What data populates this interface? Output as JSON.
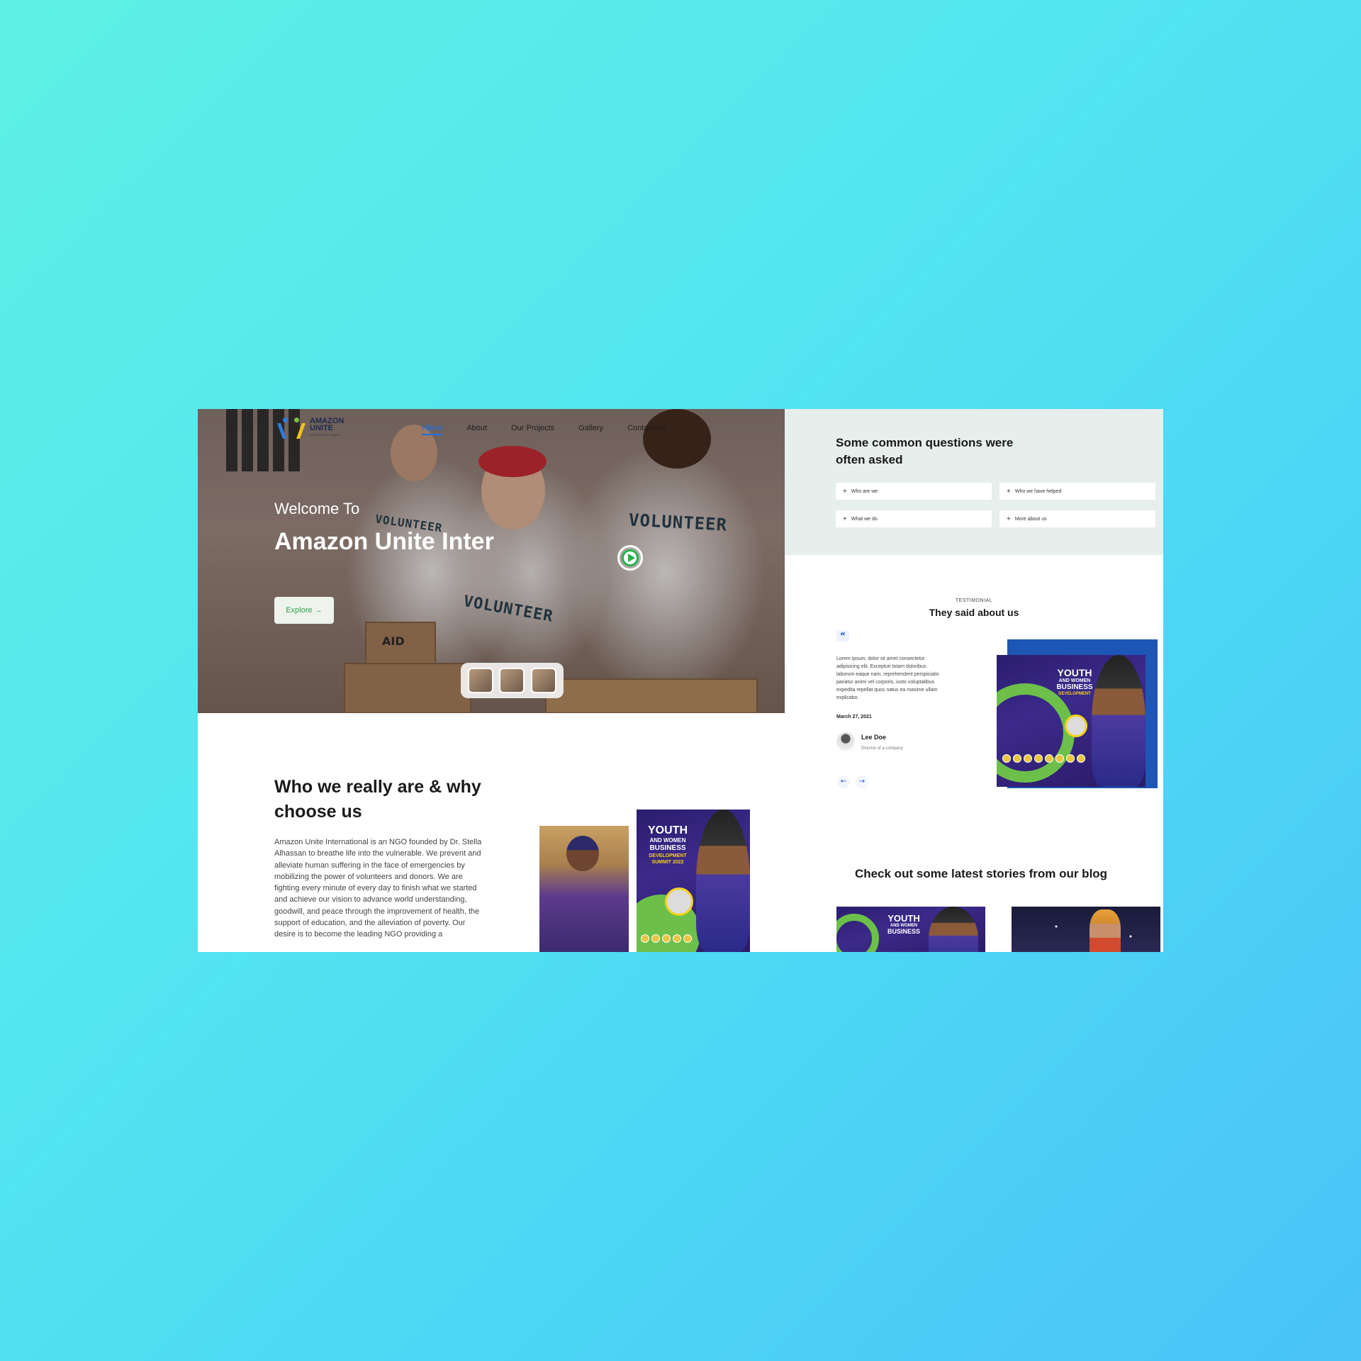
{
  "site": {
    "logo_line1": "AMAZON",
    "logo_line2": "UNITE",
    "logo_line3": "INTERNATIONAL"
  },
  "nav": {
    "items": [
      {
        "label": "Home",
        "active": true
      },
      {
        "label": "About",
        "active": false
      },
      {
        "label": "Our Projects",
        "active": false
      },
      {
        "label": "Gallery",
        "active": false
      },
      {
        "label": "Contact Us",
        "active": false
      }
    ]
  },
  "hero": {
    "subtitle": "Welcome To",
    "title": "Amazon Unite Inter",
    "explore_label": "Explore →",
    "shirt_text": "VOLUNTEER",
    "box_text": "AID"
  },
  "faq": {
    "title": "Some common questions were often asked",
    "items": [
      {
        "label": "Who are we"
      },
      {
        "label": "Who we have helped"
      },
      {
        "label": "What we do"
      },
      {
        "label": "More about us"
      }
    ]
  },
  "testimonial": {
    "kicker": "TESTIMONIAL",
    "title": "They said about us",
    "quote_mark": "“",
    "text": "Lorem ipsum, dolor sit amet consectetur adipisicing elit. Excepturi totam doloribus laborum eaque nam, reprehenderit perspiciatis pariatur animi vel corporis, iusto voluptatibus expedita repellat quos natus ea maxime ullam explicabo.",
    "date": "March 27, 2021",
    "author_name": "Lee Doe",
    "author_role": "Director of a company",
    "prev_icon": "←",
    "next_icon": "→"
  },
  "poster": {
    "line1": "YOUTH",
    "line2": "AND WOMEN",
    "line3": "BUSINESS",
    "line4": "DEVELOPMENT",
    "line5": "SUMMIT 2022"
  },
  "who": {
    "title": "Who we really are & why choose us",
    "text": "Amazon Unite International is an NGO founded by Dr. Stella Alhassan to breathe life into the vulnerable. We prevent and alleviate human suffering in the face of emergencies by mobilizing the power of volunteers and donors. We are fighting every minute of every day to finish what we started and achieve our vision to advance world understanding, goodwill, and peace through the improvement of health, the support of education, and the alleviation of poverty. Our desire is to become the leading NGO providing a"
  },
  "blog": {
    "title": "Check out some latest stories from our blog"
  },
  "icons": {
    "play": "play-icon",
    "plus": "plus-icon",
    "quote": "quote-icon",
    "arrow_left": "arrow-left-icon",
    "arrow_right": "arrow-right-icon"
  }
}
